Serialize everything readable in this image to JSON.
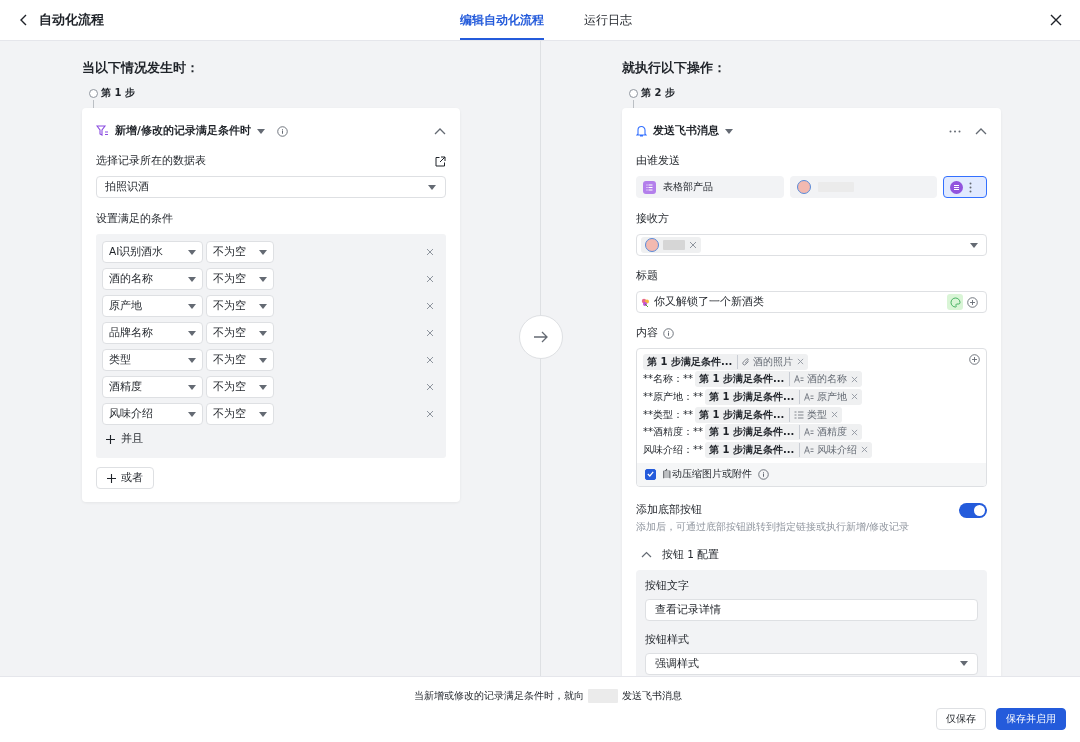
{
  "header": {
    "title": "自动化流程",
    "tabs": [
      {
        "label": "编辑自动化流程",
        "selected": true
      },
      {
        "label": "运行日志",
        "selected": false
      }
    ]
  },
  "trigger": {
    "heading": "当以下情况发生时：",
    "step": "第 1 步",
    "title": "新增/修改的记录满足条件时",
    "table_label": "选择记录所在的数据表",
    "table_value": "拍照识酒",
    "conditions_label": "设置满足的条件",
    "conditions": [
      {
        "field": "AI识别酒水",
        "operator": "不为空"
      },
      {
        "field": "酒的名称",
        "operator": "不为空"
      },
      {
        "field": "原产地",
        "operator": "不为空"
      },
      {
        "field": "品牌名称",
        "operator": "不为空"
      },
      {
        "field": "类型",
        "operator": "不为空"
      },
      {
        "field": "酒精度",
        "operator": "不为空"
      },
      {
        "field": "风味介绍",
        "operator": "不为空"
      }
    ],
    "and_button": "并且",
    "or_button": "或者"
  },
  "action": {
    "heading": "就执行以下操作：",
    "step": "第 2 步",
    "title": "发送飞书消息",
    "sender_label": "由谁发送",
    "sender_options": [
      {
        "kind": "bot",
        "label": "表格部产品",
        "selected": false
      },
      {
        "kind": "person",
        "selected": false
      },
      {
        "kind": "icon",
        "selected": true
      }
    ],
    "recipient_label": "接收方",
    "title_label": "标题",
    "title_value": "你又解锁了一个新酒类",
    "content_label": "内容",
    "content_lines": [
      {
        "step": "第 1 步满足条件...",
        "field": "酒的照片",
        "kind": "attachment"
      },
      {
        "prefix": "**名称：**",
        "step": "第 1 步满足条件...",
        "field": "酒的名称",
        "kind": "text"
      },
      {
        "prefix": "**原产地：**",
        "step": "第 1 步满足条件...",
        "field": "原产地",
        "kind": "text"
      },
      {
        "prefix": "**类型：**",
        "step": "第 1 步满足条件...",
        "field": "类型",
        "kind": "select"
      },
      {
        "prefix": "**酒精度：**",
        "step": "第 1 步满足条件...",
        "field": "酒精度",
        "kind": "text"
      },
      {
        "prefix": "风味介绍：**",
        "step": "第 1 步满足条件...",
        "field": "风味介绍",
        "kind": "text"
      }
    ],
    "compress": {
      "label": "自动压缩图片或附件",
      "checked": true
    },
    "bottom_button": {
      "label": "添加底部按钮",
      "on": true,
      "hint": "添加后，可通过底部按钮跳转到指定链接或执行新增/修改记录"
    },
    "button_config": {
      "title": "按钮 1 配置",
      "expanded": true,
      "text_label": "按钮文字",
      "text_value": "查看记录详情",
      "style_label": "按钮样式",
      "style_value": "强调样式"
    }
  },
  "footer": {
    "summary_before": "当新增或修改的记录满足条件时，就向",
    "summary_after": "发送飞书消息",
    "buttons": [
      {
        "label": "仅保存",
        "kind": "secondary"
      },
      {
        "label": "保存并启用",
        "kind": "primary"
      }
    ]
  }
}
